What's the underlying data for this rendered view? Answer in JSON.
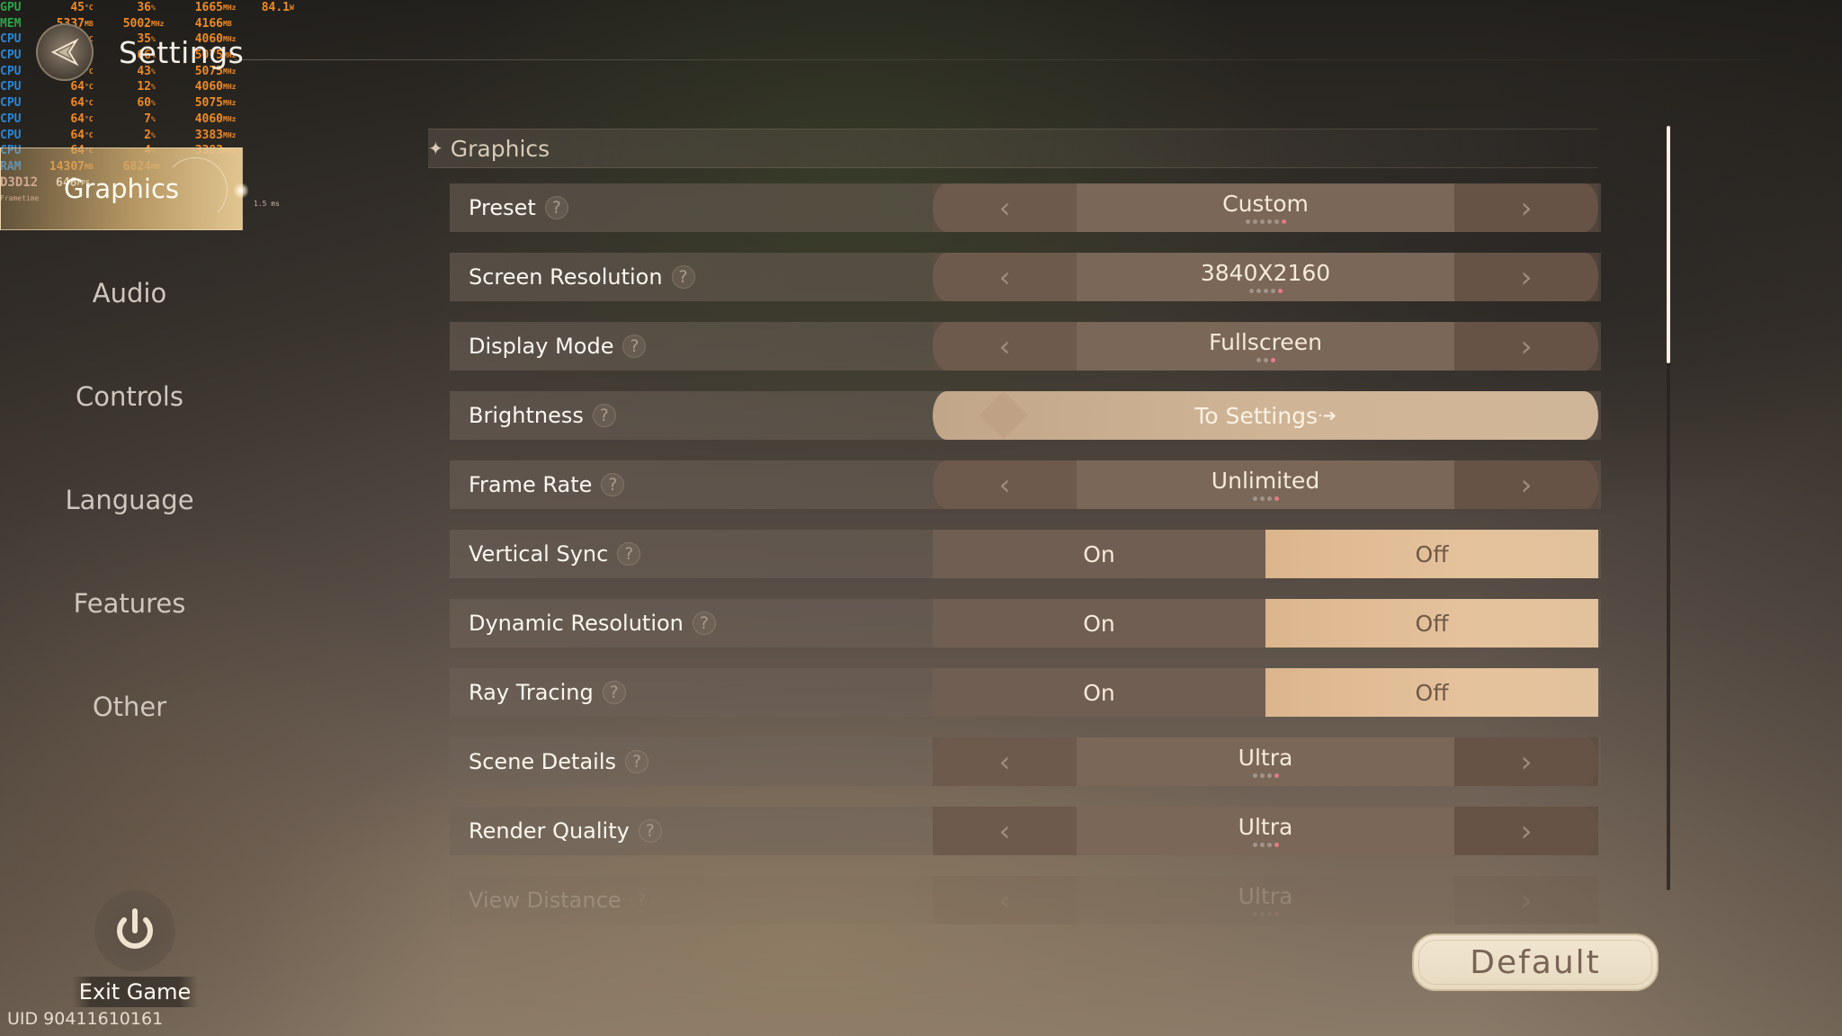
{
  "header": {
    "title": "Settings",
    "back_icon": "compass-back-icon"
  },
  "perf_overlay": {
    "rows": [
      {
        "label": "GPU",
        "sub": "2",
        "label_color": "#2fa14a",
        "c1": "45",
        "u1": "°C",
        "c2": "36",
        "u2": "%",
        "c3": "1665",
        "u3": "MHz",
        "c4": "84.1",
        "u4": "W"
      },
      {
        "label": "MEM",
        "sub": "2",
        "label_color": "#2fa14a",
        "c1": "5337",
        "u1": "MB",
        "c2": "5002",
        "u2": "MHz",
        "c3": "4166",
        "u3": "MB",
        "c4": "",
        "u4": ""
      },
      {
        "label": "CPU",
        "sub": "1",
        "label_color": "#2b86d6",
        "c1": "64",
        "u1": "°C",
        "c2": "35",
        "u2": "%",
        "c3": "4060",
        "u3": "MHz",
        "c4": "",
        "u4": ""
      },
      {
        "label": "CPU",
        "sub": "2",
        "label_color": "#2b86d6",
        "c1": "64",
        "u1": "°C",
        "c2": "66",
        "u2": "%",
        "c3": "5075",
        "u3": "MHz",
        "c4": "",
        "u4": ""
      },
      {
        "label": "CPU",
        "sub": "3",
        "label_color": "#2b86d6",
        "c1": "64",
        "u1": "°C",
        "c2": "43",
        "u2": "%",
        "c3": "5075",
        "u3": "MHz",
        "c4": "",
        "u4": ""
      },
      {
        "label": "CPU",
        "sub": "4",
        "label_color": "#2b86d6",
        "c1": "64",
        "u1": "°C",
        "c2": "12",
        "u2": "%",
        "c3": "4060",
        "u3": "MHz",
        "c4": "",
        "u4": ""
      },
      {
        "label": "CPU",
        "sub": "5",
        "label_color": "#2b86d6",
        "c1": "64",
        "u1": "°C",
        "c2": "60",
        "u2": "%",
        "c3": "5075",
        "u3": "MHz",
        "c4": "",
        "u4": ""
      },
      {
        "label": "CPU",
        "sub": "6",
        "label_color": "#2b86d6",
        "c1": "64",
        "u1": "°C",
        "c2": "7",
        "u2": "%",
        "c3": "4060",
        "u3": "MHz",
        "c4": "",
        "u4": ""
      },
      {
        "label": "CPU",
        "sub": "7",
        "label_color": "#2b86d6",
        "c1": "64",
        "u1": "°C",
        "c2": "2",
        "u2": "%",
        "c3": "3383",
        "u3": "MHz",
        "c4": "",
        "u4": ""
      },
      {
        "label": "CPU",
        "sub": "8",
        "label_color": "#2b86d6",
        "c1": "64",
        "u1": "°C",
        "c2": "4",
        "u2": "%",
        "c3": "3383",
        "u3": "MHz",
        "c4": "",
        "u4": ""
      },
      {
        "label": "RAM",
        "sub": "",
        "label_color": "#2b86d6",
        "c1": "14307",
        "u1": "MB",
        "c2": "6824",
        "u2": "MB",
        "c3": "",
        "u3": "",
        "c4": "",
        "u4": ""
      }
    ],
    "api": "D3D12",
    "fps": "646",
    "fps_unit": "FPS",
    "frametime_label": "Frametime",
    "frametime_value": "1.5 ms"
  },
  "sidebar": {
    "items": [
      {
        "label": "Graphics",
        "active": true
      },
      {
        "label": "Audio",
        "active": false
      },
      {
        "label": "Controls",
        "active": false
      },
      {
        "label": "Language",
        "active": false
      },
      {
        "label": "Features",
        "active": false
      },
      {
        "label": "Other",
        "active": false
      }
    ]
  },
  "exit": {
    "label": "Exit Game",
    "icon": "power-icon"
  },
  "uid": "UID 90411610161",
  "section": {
    "title": "Graphics"
  },
  "settings": [
    {
      "label": "Preset",
      "type": "selector",
      "value": "Custom",
      "option_count": 6,
      "selected_index": 6
    },
    {
      "label": "Screen Resolution",
      "type": "selector",
      "value": "3840X2160",
      "option_count": 5,
      "selected_index": 5
    },
    {
      "label": "Display Mode",
      "type": "selector",
      "value": "Fullscreen",
      "option_count": 3,
      "selected_index": 3
    },
    {
      "label": "Brightness",
      "type": "link",
      "value": "To Settings",
      "link_icon": "arrow-right-icon"
    },
    {
      "label": "Frame Rate",
      "type": "selector",
      "value": "Unlimited",
      "option_count": 4,
      "selected_index": 4
    },
    {
      "label": "Vertical Sync",
      "type": "toggle",
      "on_label": "On",
      "off_label": "Off",
      "value": "Off"
    },
    {
      "label": "Dynamic Resolution",
      "type": "toggle",
      "on_label": "On",
      "off_label": "Off",
      "value": "Off"
    },
    {
      "label": "Ray Tracing",
      "type": "toggle",
      "on_label": "On",
      "off_label": "Off",
      "value": "Off"
    },
    {
      "label": "Scene Details",
      "type": "selector",
      "value": "Ultra",
      "option_count": 4,
      "selected_index": 4
    },
    {
      "label": "Render Quality",
      "type": "selector",
      "value": "Ultra",
      "option_count": 4,
      "selected_index": 4
    },
    {
      "label": "View Distance",
      "type": "selector",
      "value": "Ultra",
      "option_count": 4,
      "selected_index": 4,
      "faded": true
    }
  ],
  "scrollbar": {
    "visible_fraction": 0.31,
    "scroll_position": 0.0
  },
  "default_button": {
    "label": "Default"
  },
  "colors": {
    "accent": "#e47a86",
    "toggle_selected": "#e2bf99",
    "active_tab": "#cfae78"
  }
}
